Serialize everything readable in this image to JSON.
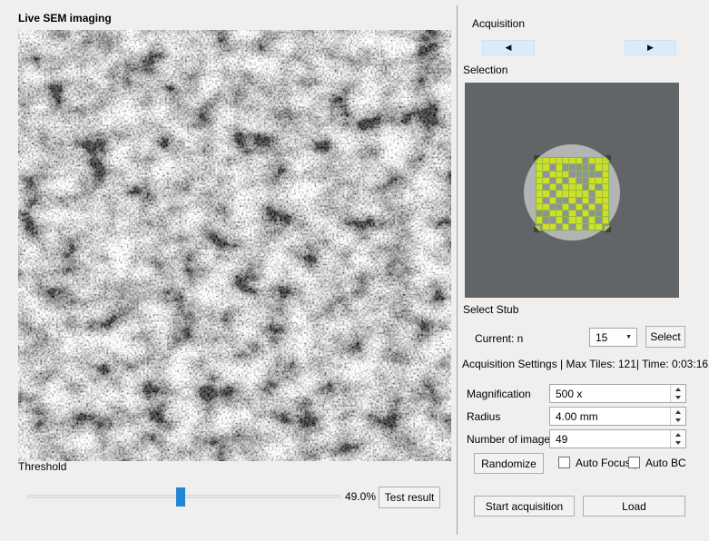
{
  "left_panel": {
    "title": "Live SEM imaging",
    "threshold": {
      "label": "Threshold",
      "value_display": "49.0%",
      "percent": 49,
      "test_button_label": "Test result"
    }
  },
  "right_panel": {
    "acquisition_label": "Acquisition",
    "selection_label": "Selection",
    "selection_view": {
      "background_color": "#616568",
      "stub_circle_color": "#b3b5b5",
      "tile_grid": {
        "rows": 11,
        "cols": 11,
        "selected_color": "#cede2c",
        "unselected_color": "#8d9398",
        "gridline_color": "#95bd3a",
        "pattern": [
          "11111110111",
          "11010000011",
          "10111000001",
          "11010100111",
          "10101110101",
          "11011111011",
          "10100101011",
          "11001010101",
          "00110101001",
          "10010110101",
          "01101010110"
        ]
      }
    },
    "select_stub": {
      "label": "Select Stub",
      "current_label": "Current: n",
      "stub_dropdown_value": "15",
      "select_button_label": "Select"
    },
    "settings_summary": "Acquisition Settings | Max Tiles: 121| Time: 0:03:16",
    "settings_fields": [
      {
        "label": "Magnification",
        "value": "500 x"
      },
      {
        "label": "Radius",
        "value": "4.00 mm"
      },
      {
        "label": "Number of images",
        "value": "49"
      }
    ],
    "randomize_button_label": "Randomize",
    "auto_focus": {
      "label": "Auto Focus |",
      "checked": false
    },
    "auto_bc": {
      "label": "Auto BC",
      "checked": false
    },
    "start_button_label": "Start acquisition",
    "load_button_label": "Load"
  },
  "icons": {
    "prev_arrow": "◀",
    "next_arrow": "▶",
    "dropdown_arrow": "▼"
  }
}
